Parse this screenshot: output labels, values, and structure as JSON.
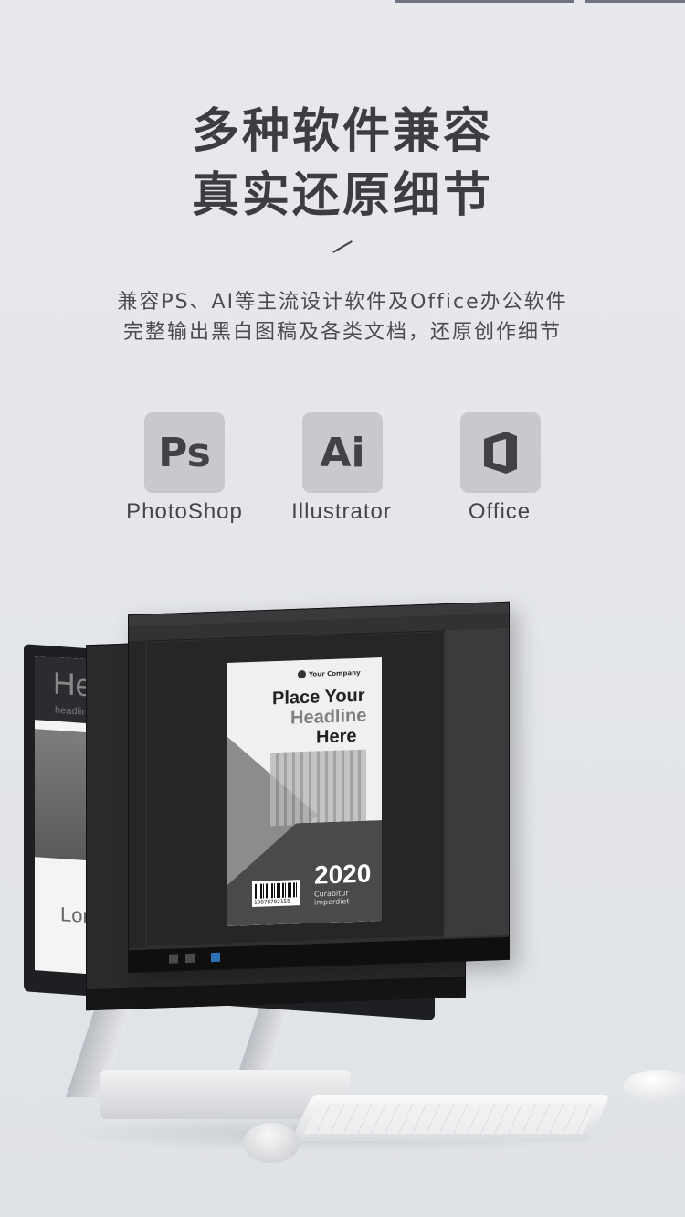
{
  "headline": {
    "line1": "多种软件兼容",
    "line2": "真实还原细节"
  },
  "description": {
    "line1": "兼容PS、AI等主流设计软件及Office办公软件",
    "line2": "完整输出黑白图稿及各类文档，还原创作细节"
  },
  "apps": [
    {
      "icon": "photoshop-icon",
      "glyph": "Ps",
      "label": "PhotoShop"
    },
    {
      "icon": "illustrator-icon",
      "glyph": "Ai",
      "label": "Illustrator"
    },
    {
      "icon": "office-icon",
      "glyph": "",
      "label": "Office"
    }
  ],
  "scene": {
    "monitor_heading": "Hea",
    "monitor_url": "headline.inc",
    "monitor_text": "Lore",
    "poster": {
      "brand": "Your Company",
      "line1": "Place Your",
      "line2": "Headline",
      "line3": "Here",
      "year": "2020",
      "subtitle": "Curabitur imperdiet",
      "barcode_number": "19878702155"
    }
  },
  "colors": {
    "background": "#e5e7eb",
    "icon_tile": "#c7c9cf",
    "text_dark": "#3c3c41"
  }
}
